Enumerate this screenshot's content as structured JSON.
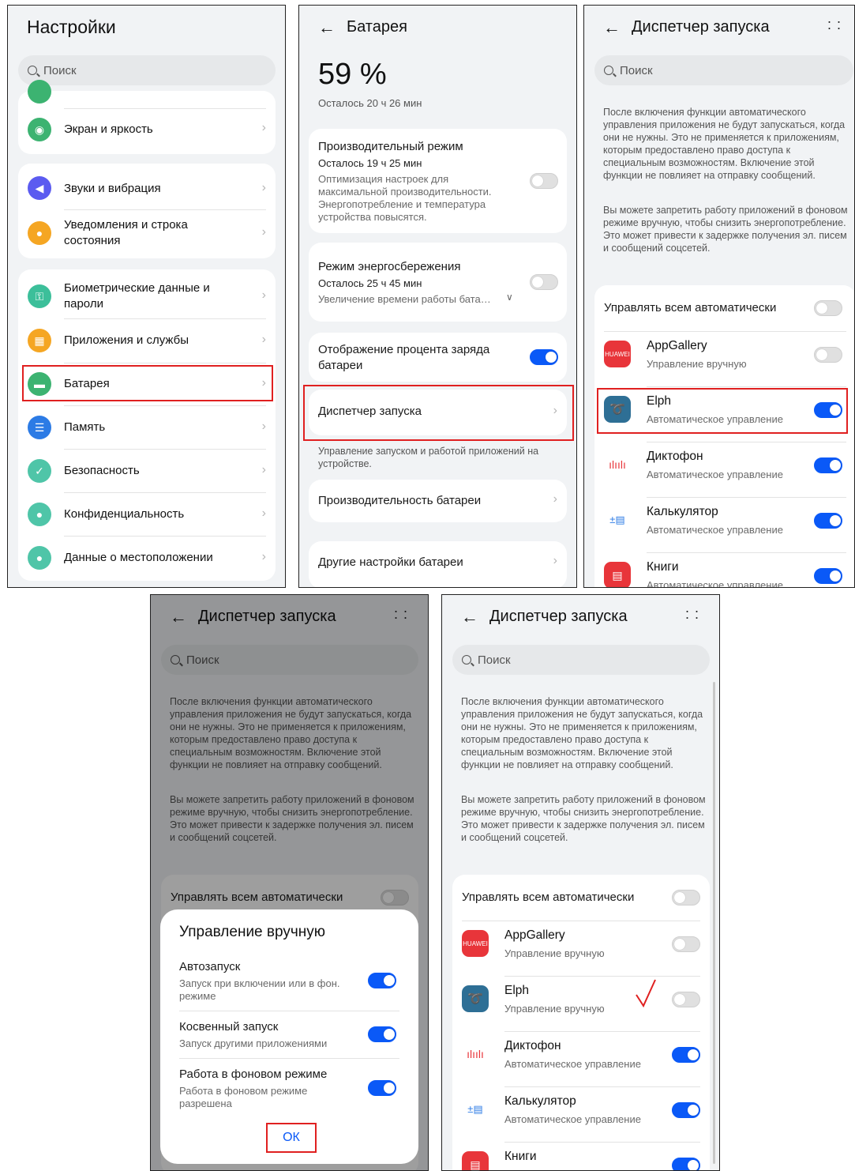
{
  "settings": {
    "title": "Настройки",
    "search_placeholder": "Поиск",
    "items": [
      {
        "label": "Экран и яркость",
        "color": "#3cb371",
        "icon": "eye-icon"
      },
      {
        "label": "Звуки и вибрация",
        "color": "#5b5bf0",
        "icon": "speaker-icon"
      },
      {
        "label": "Уведомления и строка состояния",
        "color": "#f5a623",
        "icon": "bell-icon"
      },
      {
        "label": "Биометрические данные и пароли",
        "color": "#3cbf9a",
        "icon": "key-icon"
      },
      {
        "label": "Приложения и службы",
        "color": "#f5a623",
        "icon": "apps-icon"
      },
      {
        "label": "Батарея",
        "color": "#3cb371",
        "icon": "battery-icon"
      },
      {
        "label": "Память",
        "color": "#2c7be5",
        "icon": "storage-icon"
      },
      {
        "label": "Безопасность",
        "color": "#4fc5a8",
        "icon": "shield-icon"
      },
      {
        "label": "Конфиденциальность",
        "color": "#4fc5a8",
        "icon": "privacy-icon"
      },
      {
        "label": "Данные о местоположении",
        "color": "#4fc5a8",
        "icon": "location-icon"
      }
    ]
  },
  "battery": {
    "title": "Батарея",
    "percent": "59 %",
    "remaining": "Осталось 20 ч 26 мин",
    "perf_mode": {
      "title": "Производительный режим",
      "remaining": "Осталось 19 ч 25 мин",
      "desc": "Оптимизация настроек для максимальной производительности. Энергопотребление и температура устройства повысятся.",
      "on": false
    },
    "save_mode": {
      "title": "Режим энергосбережения",
      "remaining": "Осталось 25 ч 45 мин",
      "desc": "Увеличение времени работы бата…",
      "on": false
    },
    "show_percent": {
      "title": "Отображение процента заряда батареи",
      "on": true
    },
    "launch_manager": {
      "title": "Диспетчер запуска",
      "desc": "Управление запуском и работой приложений на устройстве."
    },
    "battery_perf": "Производительность батареи",
    "other": "Другие настройки батареи"
  },
  "launch": {
    "title": "Диспетчер запуска",
    "search_placeholder": "Поиск",
    "desc1": "После включения функции автоматического управления приложения не будут запускаться, когда они не нужны. Это не применяется к приложениям, которым предоставлено право доступа к специальным возможностям. Включение этой функции не повлияет на отправку сообщений.",
    "desc2": "Вы можете запретить работу приложений в фоновом режиме вручную, чтобы снизить энергопотребление. Это может привести к задержке получения эл. писем и сообщений соцсетей.",
    "manage_all": "Управлять всем автоматически",
    "apps": [
      {
        "name": "AppGallery",
        "status": "Управление вручную",
        "on": false,
        "icon_text": "HUAWEI",
        "color": "#e8353a"
      },
      {
        "name": "Elph",
        "status": "Автоматическое управление",
        "on": true,
        "color": "#2e6f95"
      },
      {
        "name": "Диктофон",
        "status": "Автоматическое управление",
        "on": true,
        "color": "#ffffff"
      },
      {
        "name": "Калькулятор",
        "status": "Автоматическое управление",
        "on": true,
        "color": "#ffffff"
      },
      {
        "name": "Книги",
        "status": "Автоматическое управление",
        "on": true,
        "color": "#e8353a"
      }
    ],
    "elph_after": {
      "status": "Управление вручную",
      "on": false
    }
  },
  "dialog": {
    "title": "Управление вручную",
    "items": [
      {
        "title": "Автозапуск",
        "desc": "Запуск при включении или в фон. режиме",
        "on": true
      },
      {
        "title": "Косвенный запуск",
        "desc": "Запуск другими приложениями",
        "on": true
      },
      {
        "title": "Работа в фоновом режиме",
        "desc": "Работа в фоновом режиме разрешена",
        "on": true
      }
    ],
    "ok": "ОК"
  },
  "colors": {
    "accent": "#0a59f7",
    "highlight": "#e02020"
  }
}
